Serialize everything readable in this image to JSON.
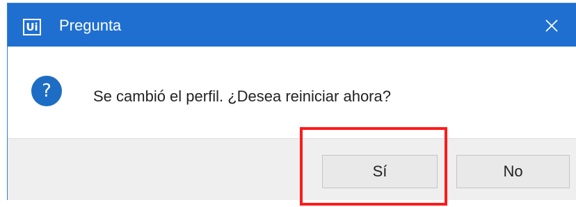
{
  "window": {
    "app_icon_text": "Ui",
    "title": "Pregunta",
    "close_icon": "close-icon"
  },
  "content": {
    "icon": "question-icon",
    "icon_glyph": "?",
    "message": "Se cambió el perfil. ¿Desea reiniciar ahora?"
  },
  "buttons": {
    "yes_label": "Sí",
    "no_label": "No"
  },
  "colors": {
    "titlebar": "#1f6fd1",
    "question_icon": "#1e6dc4",
    "highlight": "#ff1a1a",
    "footer": "#efefef"
  }
}
